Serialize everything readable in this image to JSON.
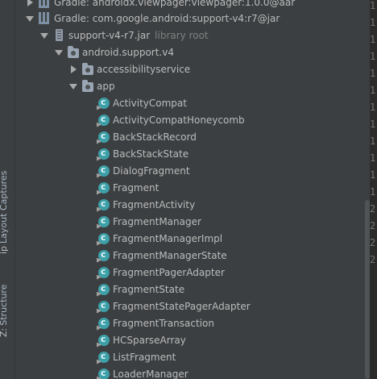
{
  "side_tabs": [
    {
      "num": "ip",
      "label": "Layout Captures"
    },
    {
      "num": "Z:",
      "label": "Structure"
    }
  ],
  "tree": {
    "gradle_viewpager": "Gradle: androidx.viewpager:viewpager:1.0.0@aar",
    "gradle_support_v4": "Gradle: com.google.android:support-v4:r7@jar",
    "jar_name": "support-v4-r7.jar",
    "jar_hint": "library root",
    "package_root": "android.support.v4",
    "package_accessibility": "accessibilityservice",
    "package_app": "app",
    "classes": [
      "ActivityCompat",
      "ActivityCompatHoneycomb",
      "BackStackRecord",
      "BackStackState",
      "DialogFragment",
      "Fragment",
      "FragmentActivity",
      "FragmentManager",
      "FragmentManagerImpl",
      "FragmentManagerState",
      "FragmentPagerAdapter",
      "FragmentState",
      "FragmentStatePagerAdapter",
      "FragmentTransaction",
      "HCSparseArray",
      "ListFragment",
      "LoaderManager"
    ]
  },
  "gutter_numbers": [
    "1",
    "1",
    "1",
    "1",
    "1",
    "1",
    "1",
    "1",
    "1",
    "1",
    "1",
    "1",
    "2",
    "2",
    "2",
    "2"
  ]
}
